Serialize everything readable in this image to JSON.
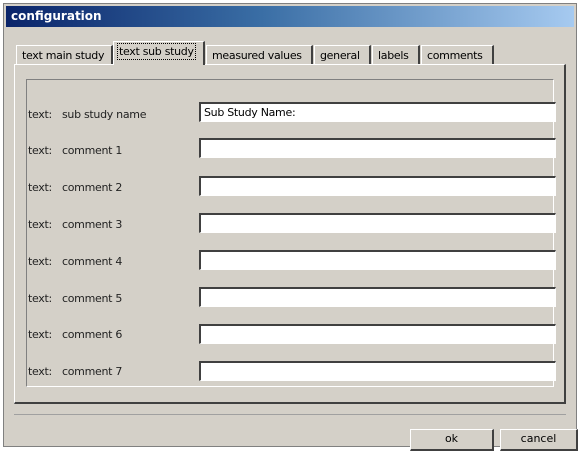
{
  "window": {
    "title": "configuration"
  },
  "tabs": [
    {
      "label": "text main study",
      "active": false
    },
    {
      "label": "text sub study",
      "active": true
    },
    {
      "label": "measured values",
      "active": false
    },
    {
      "label": "general",
      "active": false
    },
    {
      "label": "labels",
      "active": false
    },
    {
      "label": "comments",
      "active": false
    }
  ],
  "rows": [
    {
      "prefix": "text:",
      "label": "sub study name",
      "value": "Sub Study Name:"
    },
    {
      "prefix": "text:",
      "label": "comment 1",
      "value": ""
    },
    {
      "prefix": "text:",
      "label": "comment 2",
      "value": ""
    },
    {
      "prefix": "text:",
      "label": "comment 3",
      "value": ""
    },
    {
      "prefix": "text:",
      "label": "comment 4",
      "value": ""
    },
    {
      "prefix": "text:",
      "label": "comment 5",
      "value": ""
    },
    {
      "prefix": "text:",
      "label": "comment 6",
      "value": ""
    },
    {
      "prefix": "text:",
      "label": "comment 7",
      "value": ""
    }
  ],
  "buttons": {
    "ok": "ok",
    "cancel": "cancel"
  }
}
